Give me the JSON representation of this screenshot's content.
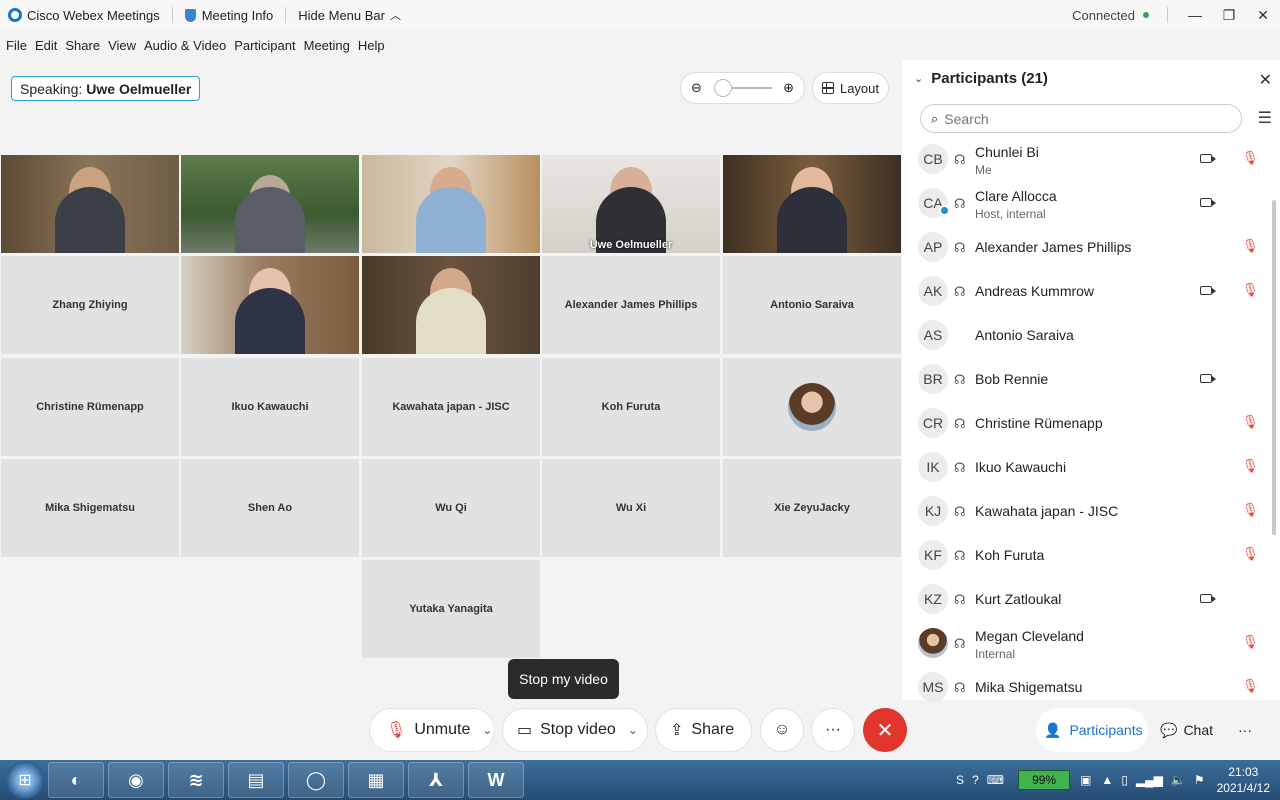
{
  "titlebar": {
    "app_name": "Cisco Webex Meetings",
    "meeting_info": "Meeting Info",
    "hide_menu": "Hide Menu Bar",
    "status": "Connected",
    "minimize": "—",
    "restore": "❐",
    "close": "✕"
  },
  "menu": [
    "File",
    "Edit",
    "Share",
    "View",
    "Audio & Video",
    "Participant",
    "Meeting",
    "Help"
  ],
  "toolbar": {
    "speaking_label": "Speaking:",
    "speaking_name": "Uwe Oelmueller",
    "layout_label": "Layout"
  },
  "tiles": [
    {
      "name": "Zhang Zhiying"
    },
    {
      "name": "Alexander James Phillips"
    },
    {
      "name": "Antonio Saraiva"
    },
    {
      "name": "Christine Rümenapp"
    },
    {
      "name": "Ikuo Kawauchi"
    },
    {
      "name": "Kawahata japan - JISC"
    },
    {
      "name": "Koh Furuta"
    },
    {
      "name": "Mika Shigematsu"
    },
    {
      "name": "Shen Ao"
    },
    {
      "name": "Wu Qi"
    },
    {
      "name": "Wu Xi"
    },
    {
      "name": "Xie ZeyuJacky"
    },
    {
      "name": "Yutaka Yanagita"
    }
  ],
  "active_speaker_label": "Uwe Oelmueller",
  "tooltip": "Stop my video",
  "controls": {
    "unmute": "Unmute",
    "stop_video": "Stop video",
    "share": "Share",
    "participants": "Participants",
    "chat": "Chat"
  },
  "panel": {
    "title": "Participants (21)",
    "search_placeholder": "Search",
    "participants": [
      {
        "initials": "CB",
        "name": "Chunlei Bi",
        "sub": "Me"
      },
      {
        "initials": "CA",
        "name": "Clare Allocca",
        "sub": "Host, internal"
      },
      {
        "initials": "AP",
        "name": "Alexander James Phillips",
        "sub": ""
      },
      {
        "initials": "AK",
        "name": "Andreas Kummrow",
        "sub": ""
      },
      {
        "initials": "AS",
        "name": "Antonio Saraiva",
        "sub": ""
      },
      {
        "initials": "BR",
        "name": "Bob Rennie",
        "sub": ""
      },
      {
        "initials": "CR",
        "name": "Christine Rümenapp",
        "sub": ""
      },
      {
        "initials": "IK",
        "name": "Ikuo Kawauchi",
        "sub": ""
      },
      {
        "initials": "KJ",
        "name": "Kawahata japan - JISC",
        "sub": ""
      },
      {
        "initials": "KF",
        "name": "Koh Furuta",
        "sub": ""
      },
      {
        "initials": "KZ",
        "name": "Kurt Zatloukal",
        "sub": ""
      },
      {
        "initials": "",
        "name": "Megan Cleveland",
        "sub": "Internal"
      },
      {
        "initials": "MS",
        "name": "Mika Shigematsu",
        "sub": ""
      }
    ]
  },
  "taskbar": {
    "battery": "99%",
    "time": "21:03",
    "date": "2021/4/12"
  }
}
